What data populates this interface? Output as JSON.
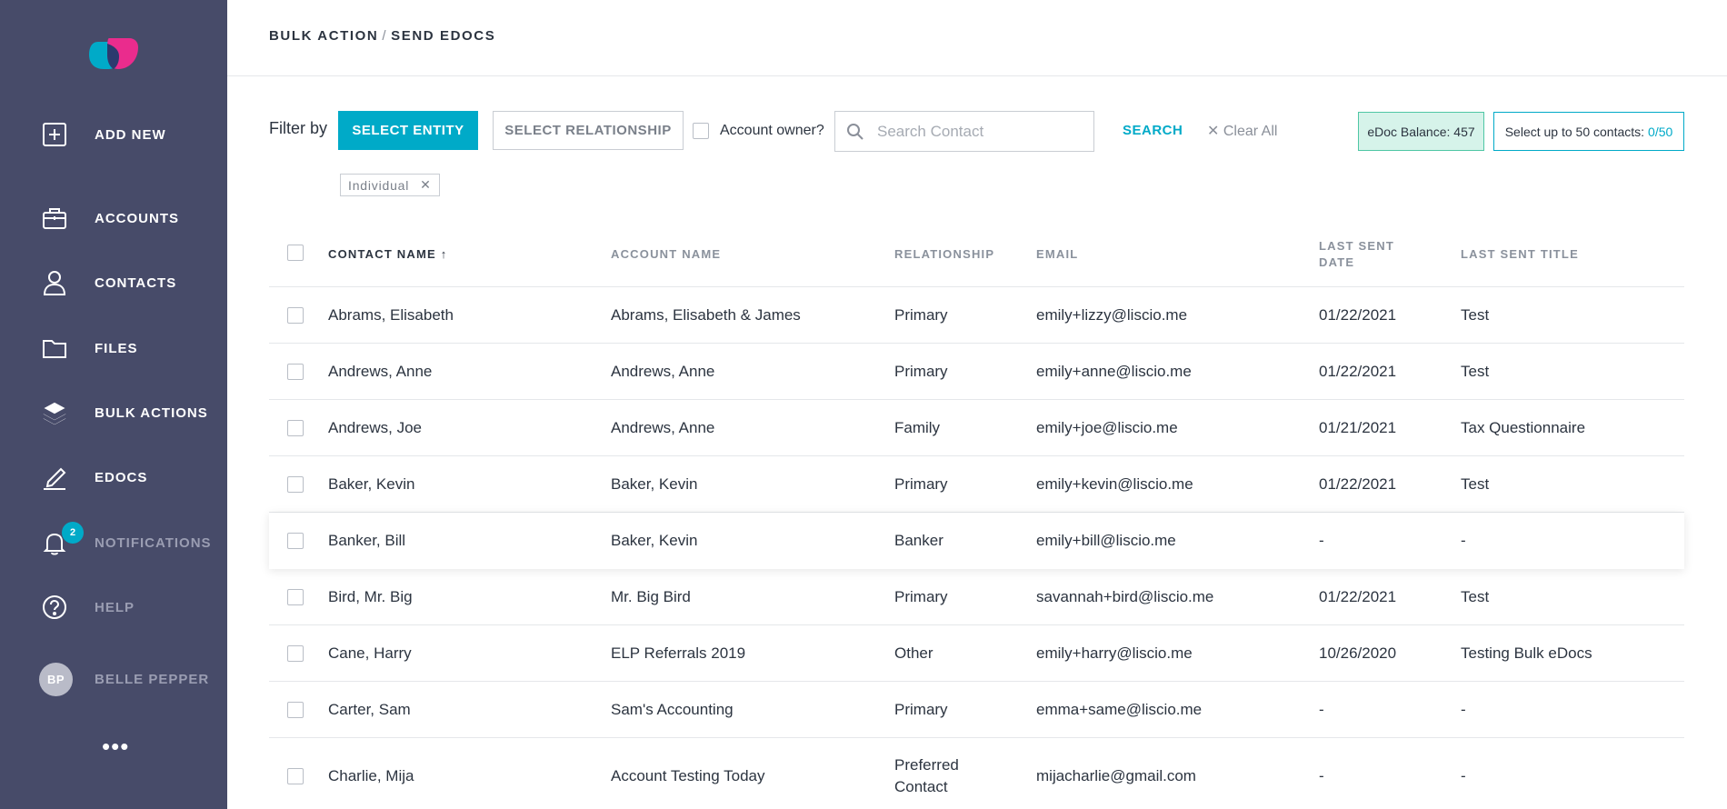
{
  "sidebar": {
    "items": [
      {
        "label": "ADD NEW",
        "icon": "plus-square-icon"
      },
      {
        "label": "ACCOUNTS",
        "icon": "briefcase-icon"
      },
      {
        "label": "CONTACTS",
        "icon": "user-icon"
      },
      {
        "label": "FILES",
        "icon": "folder-icon"
      },
      {
        "label": "BULK ACTIONS",
        "icon": "layers-icon"
      },
      {
        "label": "EDOCS",
        "icon": "pen-icon"
      },
      {
        "label": "NOTIFICATIONS",
        "icon": "bell-icon",
        "badge": "2"
      },
      {
        "label": "HELP",
        "icon": "help-icon"
      }
    ],
    "user": {
      "initials": "BP",
      "name": "BELLE PEPPER"
    },
    "more": "•••"
  },
  "header": {
    "crumb_parent": "BULK ACTION",
    "crumb_separator": "/",
    "crumb_current": "SEND EDOCS"
  },
  "filters": {
    "label": "Filter by",
    "entity_button": "SELECT ENTITY",
    "relationship_button": "SELECT RELATIONSHIP",
    "owner_label": "Account owner?",
    "search_placeholder": "Search Contact",
    "search_button": "SEARCH",
    "clear_all": "✕ Clear All",
    "balance": "eDoc Balance: 457",
    "select_up_label": "Select up to 50 contacts:",
    "select_up_count": "0/50",
    "chip": "Individual",
    "chip_remove": "✕"
  },
  "table": {
    "columns": {
      "name": "CONTACT NAME",
      "sort_indicator": "↑",
      "account": "ACCOUNT NAME",
      "relationship": "RELATIONSHIP",
      "email": "EMAIL",
      "last_sent_date": "LAST SENT DATE",
      "last_sent_title": "LAST SENT TITLE"
    },
    "rows": [
      {
        "name": "Abrams, Elisabeth",
        "account": "Abrams, Elisabeth & James",
        "relationship": "Primary",
        "email": "emily+lizzy@liscio.me",
        "date": "01/22/2021",
        "title": "Test"
      },
      {
        "name": "Andrews, Anne",
        "account": "Andrews, Anne",
        "relationship": "Primary",
        "email": "emily+anne@liscio.me",
        "date": "01/22/2021",
        "title": "Test"
      },
      {
        "name": "Andrews, Joe",
        "account": "Andrews, Anne",
        "relationship": "Family",
        "email": "emily+joe@liscio.me",
        "date": "01/21/2021",
        "title": "Tax Questionnaire"
      },
      {
        "name": "Baker, Kevin",
        "account": "Baker, Kevin",
        "relationship": "Primary",
        "email": "emily+kevin@liscio.me",
        "date": "01/22/2021",
        "title": "Test"
      },
      {
        "name": "Banker, Bill",
        "account": "Baker, Kevin",
        "relationship": "Banker",
        "email": "emily+bill@liscio.me",
        "date": "-",
        "title": "-"
      },
      {
        "name": "Bird, Mr. Big",
        "account": "Mr. Big Bird",
        "relationship": "Primary",
        "email": "savannah+bird@liscio.me",
        "date": "01/22/2021",
        "title": "Test"
      },
      {
        "name": "Cane, Harry",
        "account": "ELP Referrals 2019",
        "relationship": "Other",
        "email": "emily+harry@liscio.me",
        "date": "10/26/2020",
        "title": "Testing Bulk eDocs"
      },
      {
        "name": "Carter, Sam",
        "account": "Sam's Accounting",
        "relationship": "Primary",
        "email": "emma+same@liscio.me",
        "date": "-",
        "title": "-"
      },
      {
        "name": "Charlie, Mija",
        "account": "Account Testing Today",
        "relationship": "Preferred Contact",
        "email": "mijacharlie@gmail.com",
        "date": "-",
        "title": "-"
      }
    ]
  },
  "colors": {
    "sidebar_bg": "#474b69",
    "accent": "#00aac8",
    "balance_bg": "#d6f3ea",
    "balance_border": "#4fc7a5"
  }
}
